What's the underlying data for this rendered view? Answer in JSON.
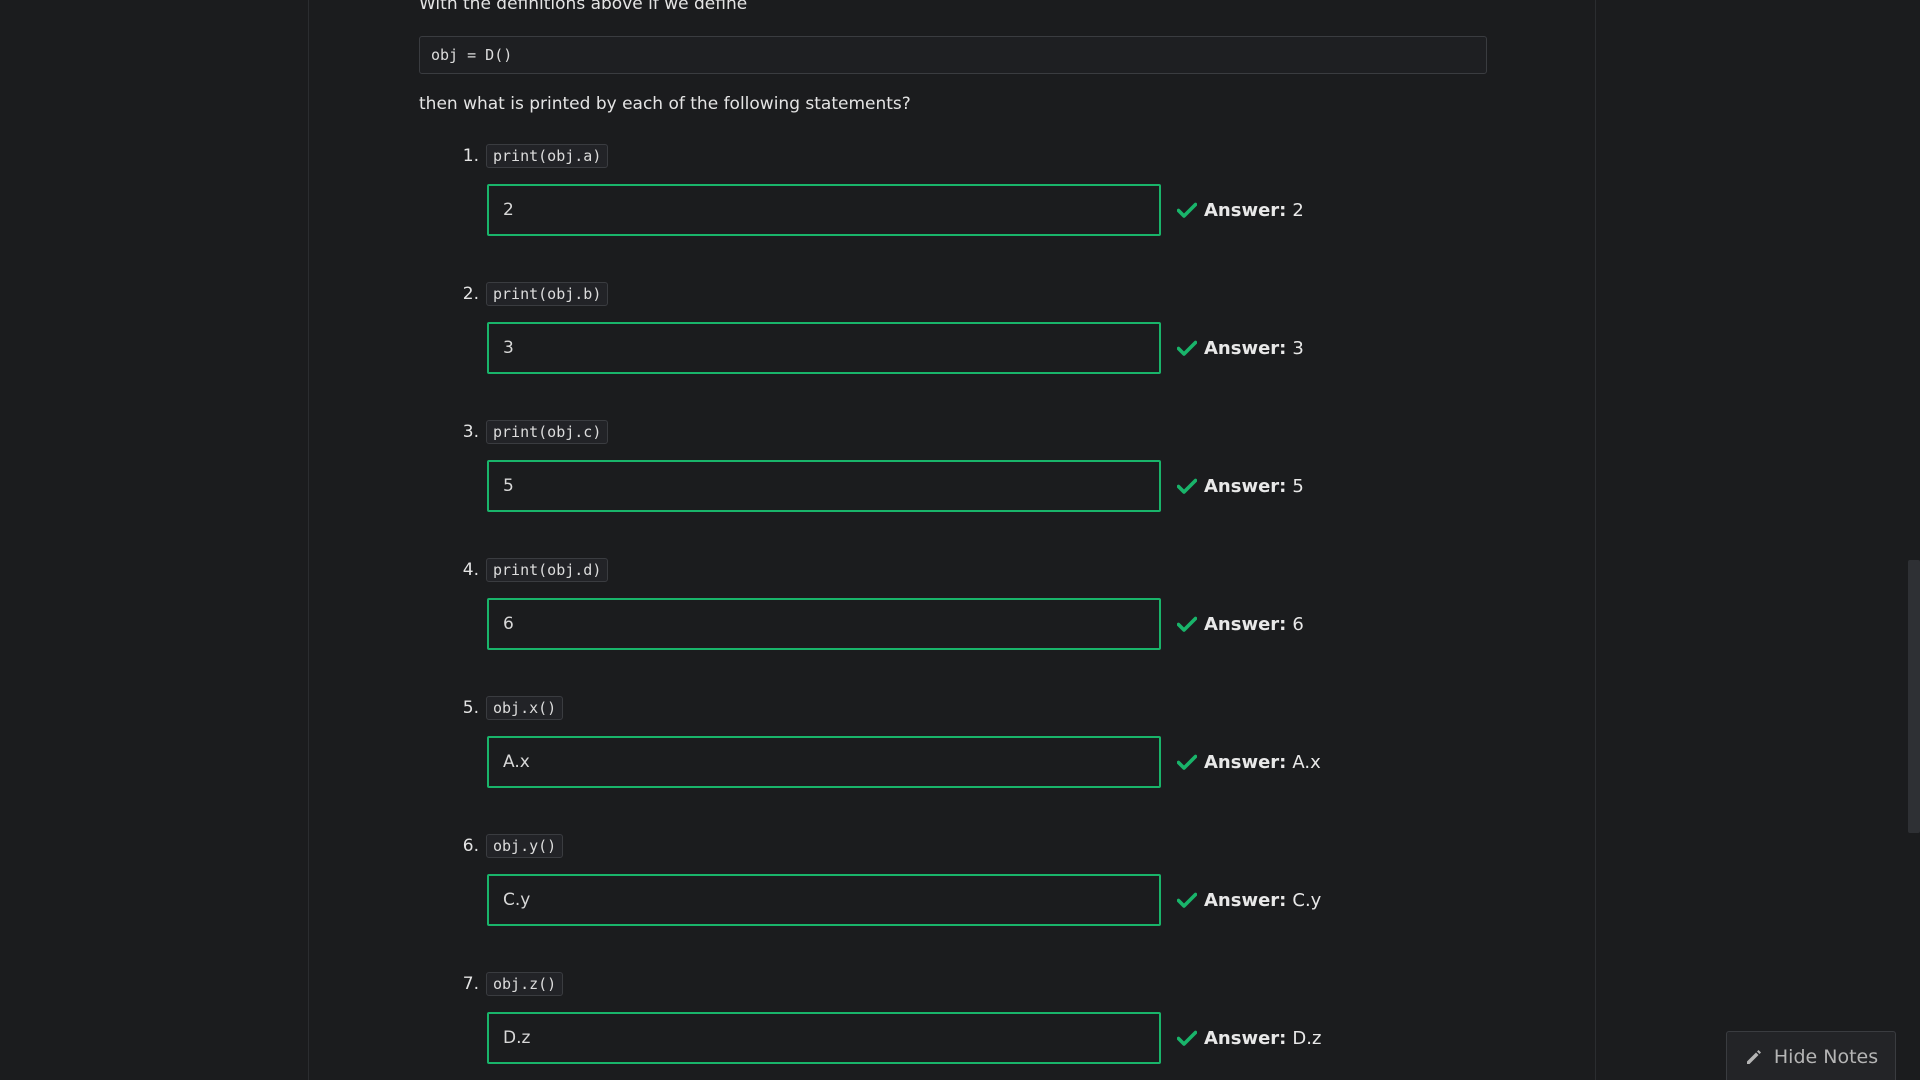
{
  "intro_text": "With the definitions above if we define",
  "code_definition": "obj = D()",
  "followup_text": "then what is printed by each of the following statements?",
  "answer_label": "Answer:",
  "accent_color": "#19b46a",
  "questions": [
    {
      "number": "1.",
      "code": "print(obj.a)",
      "input_value": "2",
      "answer": "2"
    },
    {
      "number": "2.",
      "code": "print(obj.b)",
      "input_value": "3",
      "answer": "3"
    },
    {
      "number": "3.",
      "code": "print(obj.c)",
      "input_value": "5",
      "answer": "5"
    },
    {
      "number": "4.",
      "code": "print(obj.d)",
      "input_value": "6",
      "answer": "6"
    },
    {
      "number": "5.",
      "code": "obj.x()",
      "input_value": "A.x",
      "answer": "A.x"
    },
    {
      "number": "6.",
      "code": "obj.y()",
      "input_value": "C.y",
      "answer": "C.y"
    },
    {
      "number": "7.",
      "code": "obj.z()",
      "input_value": "D.z",
      "answer": "D.z"
    }
  ],
  "hide_notes_button": {
    "label": "Hide Notes",
    "icon": "pencil-icon"
  }
}
